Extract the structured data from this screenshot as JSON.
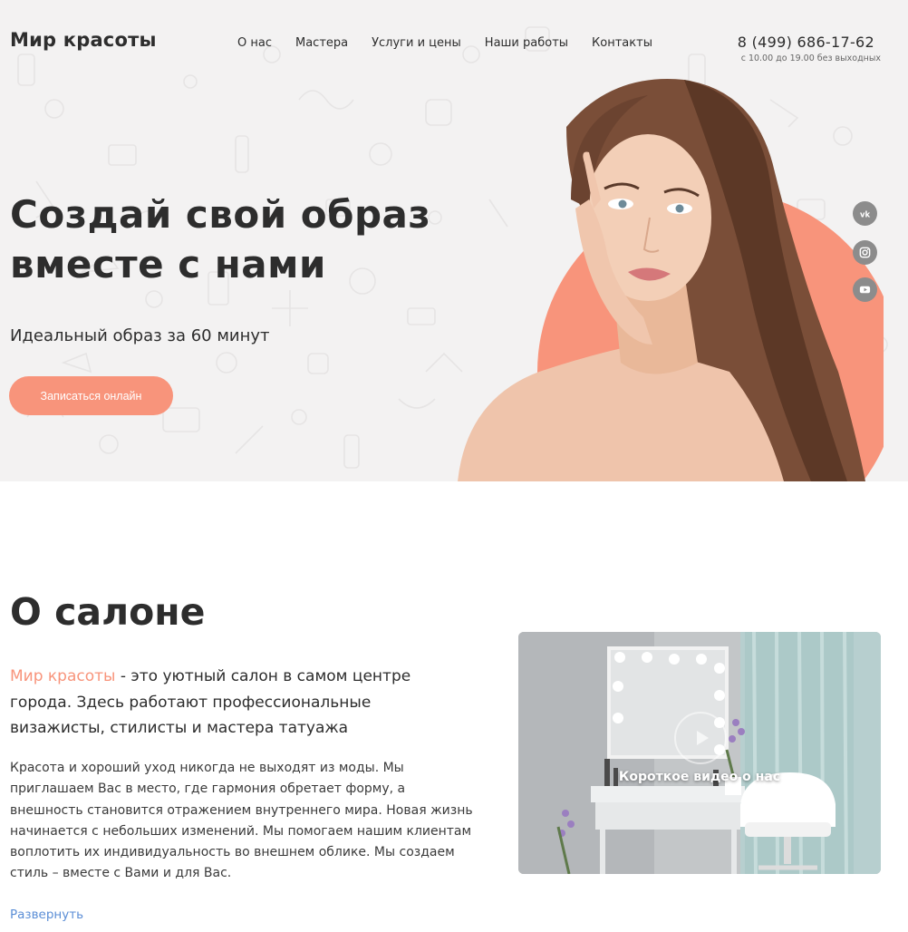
{
  "header": {
    "logo": "Мир красоты",
    "nav": [
      "О нас",
      "Мастера",
      "Услуги и цены",
      "Наши работы",
      "Контакты"
    ],
    "phone": "8 (499) 686-17-62",
    "hours": "с 10.00 до 19.00 без выходных"
  },
  "hero": {
    "title_line1": "Создай свой образ",
    "title_line2": "вместе с нами",
    "subtitle": "Идеальный образ за 60 минут",
    "cta_label": "Записаться онлайн",
    "social": [
      "vk-icon",
      "instagram-icon",
      "youtube-icon"
    ]
  },
  "about": {
    "title": "О салоне",
    "lead_brand": "Мир красоты",
    "lead_rest": " - это уютный салон в самом центре города. Здесь работают профессиональные визажисты, стилисты и мастера татуажа",
    "body": "Красота и хороший уход никогда не выходят из моды. Мы приглашаем Вас в место, где гармония обретает форму, а внешность становится отражением внутреннего мира. Новая жизнь начинается с небольших изменений. Мы помогаем нашим клиентам воплотить их индивидуальность во внешнем облике. Мы создаем стиль – вместе с Вами и для Вас.",
    "expand_label": "Развернуть",
    "video_caption": "Короткое видео о нас"
  },
  "colors": {
    "accent": "#f8947b",
    "hero_bg": "#f3f2f2",
    "text": "#2d2d2d",
    "link": "#5b8ed6",
    "social_bg": "#8c8c8c"
  }
}
